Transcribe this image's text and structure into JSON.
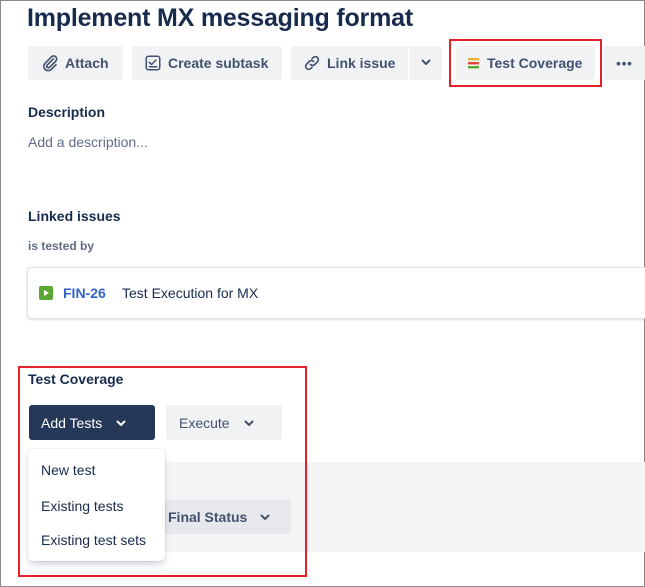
{
  "issue": {
    "title": "Implement MX messaging format"
  },
  "toolbar": {
    "attach_label": "Attach",
    "create_subtask_label": "Create subtask",
    "link_issue_label": "Link issue",
    "test_coverage_label": "Test Coverage",
    "more_label": "•••"
  },
  "description": {
    "heading": "Description",
    "placeholder": "Add a description..."
  },
  "linked_issues": {
    "heading": "Linked issues",
    "relation": "is tested by",
    "items": [
      {
        "key": "FIN-26",
        "summary": "Test Execution for MX",
        "type_icon": "test-execution-icon",
        "type_color": "#5aa832"
      }
    ]
  },
  "test_coverage": {
    "heading": "Test Coverage",
    "add_tests_label": "Add Tests",
    "execute_label": "Execute",
    "final_status_label": "Final Status",
    "add_tests_menu": [
      "New test",
      "Existing tests",
      "Existing test sets"
    ]
  },
  "colors": {
    "highlight": "#e3212b",
    "primary_dark": "#253858",
    "link": "#2f63c9"
  }
}
